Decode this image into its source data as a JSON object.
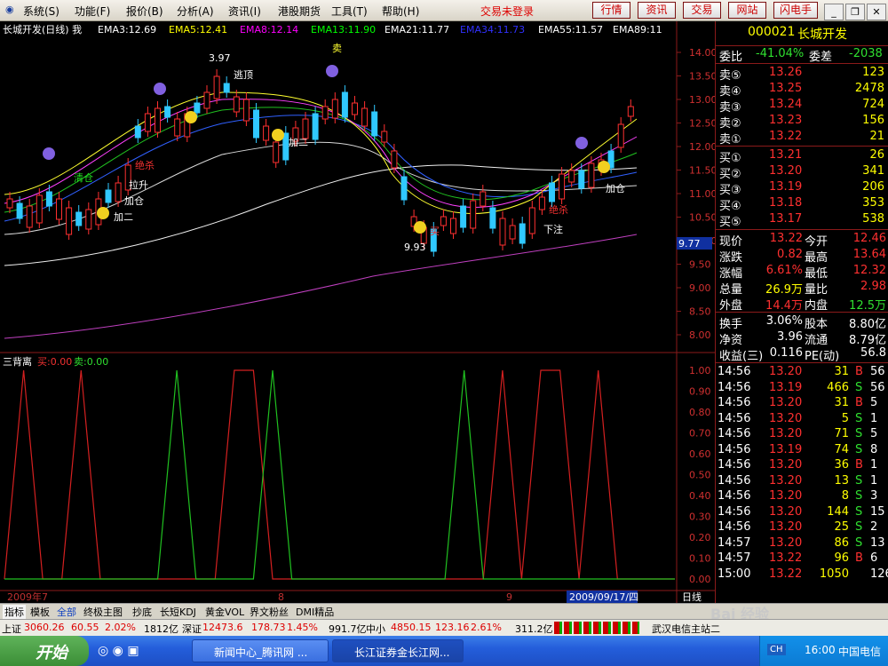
{
  "menu": {
    "items": [
      "系统(S)",
      "功能(F)",
      "报价(B)",
      "分析(A)",
      "资讯(I)",
      "港股期货",
      "工具(T)",
      "帮助(H)"
    ],
    "login_status": "交易未登录",
    "buttons": [
      "行情",
      "资讯",
      "交易",
      "网站",
      "闪电手"
    ]
  },
  "chart": {
    "title": "长城开发(日线) 我",
    "emas": [
      {
        "label": "EMA3:12.69",
        "color": "#ffffff"
      },
      {
        "label": "EMA5:12.41",
        "color": "#ffff00"
      },
      {
        "label": "EMA8:12.14",
        "color": "#ff00ff"
      },
      {
        "label": "EMA13:11.90",
        "color": "#00ff00"
      },
      {
        "label": "EMA21:11.77",
        "color": "#ffffff"
      },
      {
        "label": "EMA34:11.73",
        "color": "#3030ff"
      },
      {
        "label": "EMA55:11.57",
        "color": "#ffffff"
      },
      {
        "label": "EMA89:11",
        "color": "#ffffff"
      }
    ],
    "price_ticks": [
      "14.00",
      "13.50",
      "13.00",
      "12.50",
      "12.00",
      "11.50",
      "11.00",
      "10.50",
      "10.00",
      "9.50",
      "9.00",
      "8.50",
      "8.00"
    ],
    "price_tag": "9.77",
    "high_label": "3.97",
    "low_label": "9.93",
    "indicator_name": "三背离",
    "buy_label": "买:0.00",
    "sell_label": "卖:0.00",
    "ind_ticks": [
      "1.00",
      "0.90",
      "0.80",
      "0.70",
      "0.60",
      "0.50",
      "0.40",
      "0.30",
      "0.20",
      "0.10",
      "0.00"
    ],
    "dates": [
      "2009年7",
      "8",
      "9"
    ],
    "current_date": "2009/09/17/四",
    "period": "日线",
    "signals": [
      "清仓",
      "拉升",
      "加仓",
      "加二",
      "绝杀",
      "逃顶",
      "下注",
      "买",
      "卖",
      "止损"
    ]
  },
  "chart_data": {
    "type": "line",
    "series": [
      {
        "name": "买",
        "color": "#d42020",
        "values": [
          0,
          1,
          0,
          0,
          1,
          0,
          0,
          0,
          0,
          0,
          0,
          0,
          1,
          1,
          0,
          0,
          0,
          0,
          0,
          0,
          0,
          0,
          0,
          0,
          0,
          0,
          1,
          0,
          1,
          1,
          0,
          1,
          0,
          0,
          0,
          0
        ]
      },
      {
        "name": "卖",
        "color": "#20c020",
        "values": [
          0,
          0,
          0,
          0,
          0,
          0,
          0,
          0,
          0,
          1,
          0,
          0,
          0,
          0,
          1,
          0,
          0,
          0,
          0,
          0,
          0,
          0,
          0,
          0,
          1,
          0,
          0,
          0,
          0,
          0,
          0,
          0,
          0,
          0,
          0,
          0
        ]
      }
    ],
    "ylim": [
      0,
      1
    ]
  },
  "quote": {
    "code": "000021",
    "name": "长城开发",
    "wei_bi_label": "委比",
    "wei_bi": "-41.04%",
    "wei_cha_label": "委差",
    "wei_cha": "-2038",
    "sells": [
      {
        "label": "卖⑤",
        "price": "13.26",
        "vol": "123"
      },
      {
        "label": "卖④",
        "price": "13.25",
        "vol": "2478"
      },
      {
        "label": "卖③",
        "price": "13.24",
        "vol": "724"
      },
      {
        "label": "卖②",
        "price": "13.23",
        "vol": "156"
      },
      {
        "label": "卖①",
        "price": "13.22",
        "vol": "21"
      }
    ],
    "buys": [
      {
        "label": "买①",
        "price": "13.21",
        "vol": "26"
      },
      {
        "label": "买②",
        "price": "13.20",
        "vol": "341"
      },
      {
        "label": "买③",
        "price": "13.19",
        "vol": "206"
      },
      {
        "label": "买④",
        "price": "13.18",
        "vol": "353"
      },
      {
        "label": "买⑤",
        "price": "13.17",
        "vol": "538"
      }
    ],
    "stats": [
      {
        "l1": "现价",
        "v1": "13.22",
        "l2": "今开",
        "v2": "12.46"
      },
      {
        "l1": "涨跌",
        "v1": "0.82",
        "l2": "最高",
        "v2": "13.64"
      },
      {
        "l1": "涨幅",
        "v1": "6.61%",
        "l2": "最低",
        "v2": "12.32"
      },
      {
        "l1": "总量",
        "v1": "26.9万",
        "l2": "量比",
        "v2": "2.98"
      },
      {
        "l1": "外盘",
        "v1": "14.4万",
        "l2": "内盘",
        "v2": "12.5万"
      },
      {
        "l1": "换手",
        "v1": "3.06%",
        "l2": "股本",
        "v2": "8.80亿"
      },
      {
        "l1": "净资",
        "v1": "3.96",
        "l2": "流通",
        "v2": "8.79亿"
      },
      {
        "l1": "收益(三)",
        "v1": "0.116",
        "l2": "PE(动)",
        "v2": "56.8"
      }
    ],
    "ticks": [
      {
        "t": "14:56",
        "p": "13.20",
        "v": "31",
        "d": "B",
        "n": "56"
      },
      {
        "t": "14:56",
        "p": "13.19",
        "v": "466",
        "d": "S",
        "n": "56"
      },
      {
        "t": "14:56",
        "p": "13.20",
        "v": "31",
        "d": "B",
        "n": "5"
      },
      {
        "t": "14:56",
        "p": "13.20",
        "v": "5",
        "d": "S",
        "n": "1"
      },
      {
        "t": "14:56",
        "p": "13.20",
        "v": "71",
        "d": "S",
        "n": "5"
      },
      {
        "t": "14:56",
        "p": "13.19",
        "v": "74",
        "d": "S",
        "n": "8"
      },
      {
        "t": "14:56",
        "p": "13.20",
        "v": "36",
        "d": "B",
        "n": "1"
      },
      {
        "t": "14:56",
        "p": "13.20",
        "v": "13",
        "d": "S",
        "n": "1"
      },
      {
        "t": "14:56",
        "p": "13.20",
        "v": "8",
        "d": "S",
        "n": "3"
      },
      {
        "t": "14:56",
        "p": "13.20",
        "v": "144",
        "d": "S",
        "n": "15"
      },
      {
        "t": "14:56",
        "p": "13.20",
        "v": "25",
        "d": "S",
        "n": "2"
      },
      {
        "t": "14:57",
        "p": "13.20",
        "v": "86",
        "d": "S",
        "n": "13"
      },
      {
        "t": "14:57",
        "p": "13.22",
        "v": "96",
        "d": "B",
        "n": "6"
      },
      {
        "t": "15:00",
        "p": "13.22",
        "v": "1050",
        "d": "",
        "n": "126"
      }
    ]
  },
  "bottom_tabs": [
    "指标",
    "模板",
    "全部",
    "终极主图",
    "抄底",
    "长短KDJ",
    "黄金VOL",
    "界文粉丝",
    "DMI精品"
  ],
  "index_bar": {
    "sh_label": "上证",
    "sh": "3060.26",
    "sh_chg": "60.55",
    "sh_pct": "2.02%",
    "sh_amt": "1812亿",
    "sz_label": "深证",
    "sz": "12473.6",
    "sz_chg": "178.73",
    "sz_pct": "1.45%",
    "sz_amt": "991.7亿",
    "zx_label": "中小",
    "zx": "4850.15",
    "zx_chg": "123.16",
    "zx_pct": "2.61%",
    "zx_amt": "311.2亿",
    "server": "武汉电信主站二"
  },
  "taskbar": {
    "start": "开始",
    "tasks": [
      "新闻中心_腾讯网 ...",
      "长江证券金长江网..."
    ],
    "clock": "16:00",
    "tray_text": "中国电信",
    "ime": "CH"
  },
  "watermark": "Bai 经验 jingyan.baidu.com"
}
